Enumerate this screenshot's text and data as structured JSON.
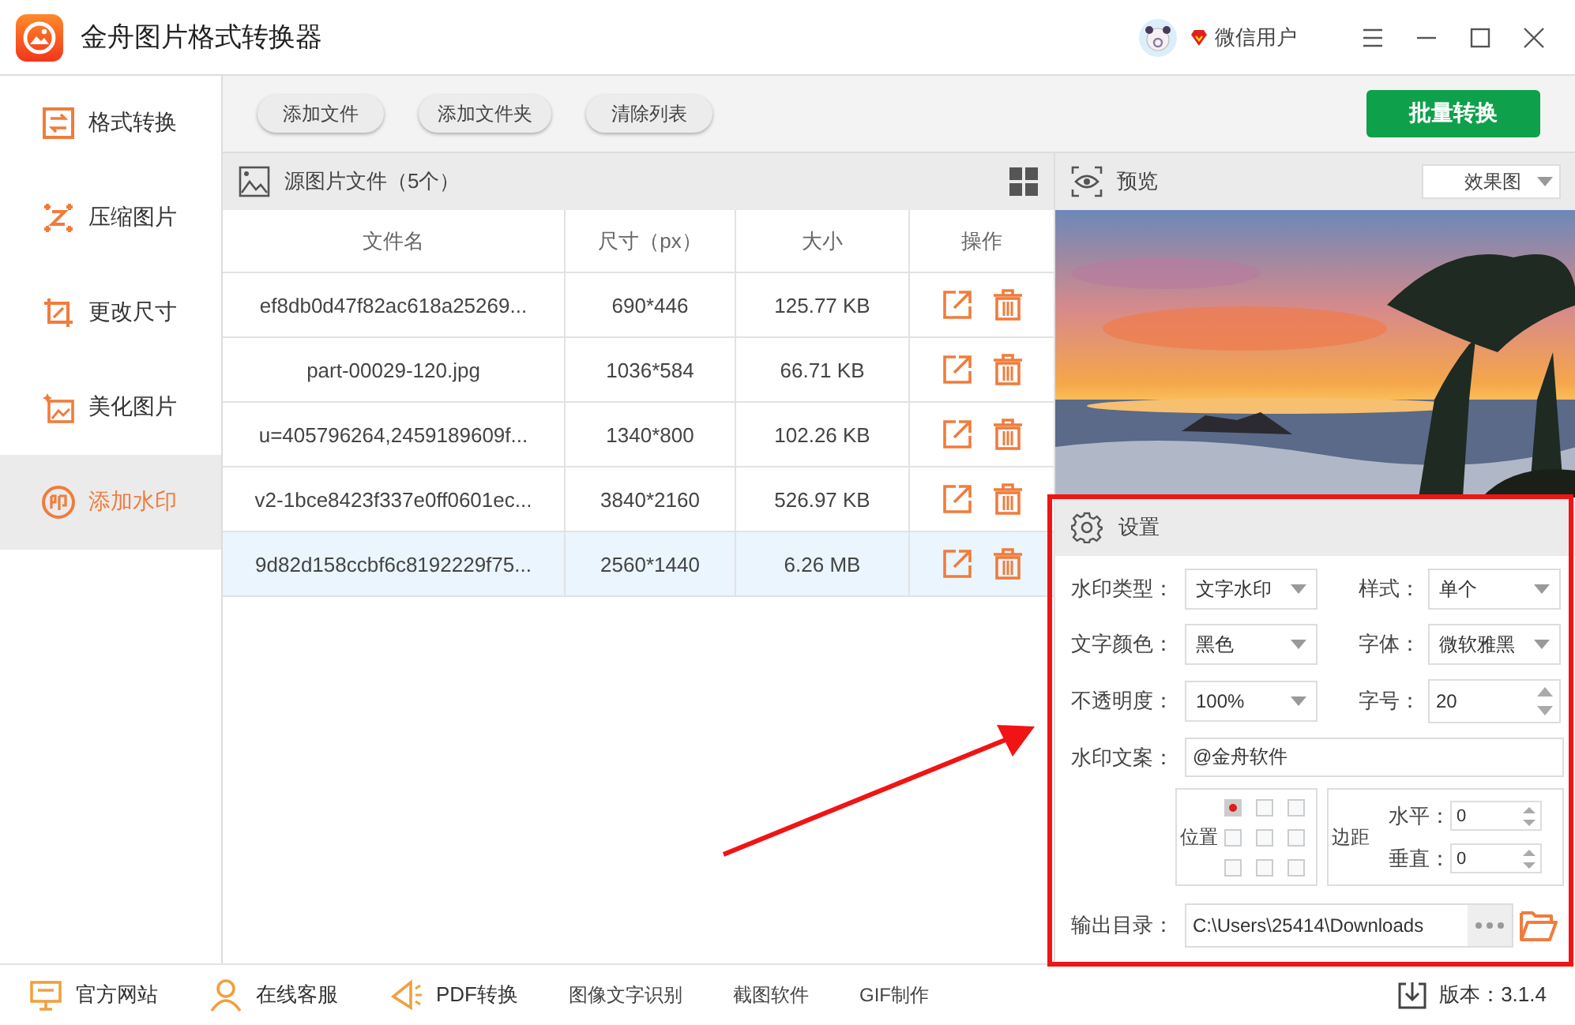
{
  "window": {
    "title": "金舟图片格式转换器",
    "user": "微信用户"
  },
  "sidebar": {
    "items": [
      {
        "label": "格式转换",
        "selected": false
      },
      {
        "label": "压缩图片",
        "selected": false
      },
      {
        "label": "更改尺寸",
        "selected": false
      },
      {
        "label": "美化图片",
        "selected": false
      },
      {
        "label": "添加水印",
        "selected": true
      }
    ]
  },
  "toolbar": {
    "buttons": [
      "添加文件",
      "添加文件夹",
      "清除列表"
    ],
    "primary_button": "批量转换"
  },
  "file_list": {
    "title": "源图片文件（5个）",
    "columns": [
      "文件名",
      "尺寸（px）",
      "大小",
      "操作"
    ],
    "rows": [
      {
        "name": "ef8db0d47f82ac618a25269...",
        "dimensions": "690*446",
        "size": "125.77 KB",
        "selected": false
      },
      {
        "name": "part-00029-120.jpg",
        "dimensions": "1036*584",
        "size": "66.71 KB",
        "selected": false
      },
      {
        "name": "u=405796264,2459189609f...",
        "dimensions": "1340*800",
        "size": "102.26 KB",
        "selected": false
      },
      {
        "name": "v2-1bce8423f337e0ff0601ec...",
        "dimensions": "3840*2160",
        "size": "526.97 KB",
        "selected": false
      },
      {
        "name": "9d82d158ccbf6c8192229f75...",
        "dimensions": "2560*1440",
        "size": "6.26 MB",
        "selected": true
      }
    ]
  },
  "preview": {
    "title": "预览",
    "mode": "效果图"
  },
  "settings": {
    "title": "设置",
    "fields": [
      {
        "label": "水印类型：",
        "kind": "dropdown",
        "value": "文字水印"
      },
      {
        "label": "样式：",
        "kind": "dropdown",
        "value": "单个"
      },
      {
        "label": "文字颜色：",
        "kind": "dropdown",
        "value": "黑色"
      },
      {
        "label": "字体：",
        "kind": "dropdown",
        "value": "微软雅黑"
      },
      {
        "label": "不透明度：",
        "kind": "dropdown",
        "value": "100%"
      },
      {
        "label": "字号：",
        "kind": "spinner",
        "value": "20"
      }
    ],
    "text": {
      "label": "水印文案：",
      "value": "@金舟软件"
    },
    "position": {
      "label": "位置",
      "cells": [
        {
          "selected": true
        },
        {
          "selected": false
        },
        {
          "selected": false
        },
        {
          "selected": false
        },
        {
          "selected": false
        },
        {
          "selected": false
        },
        {
          "selected": false
        },
        {
          "selected": false
        },
        {
          "selected": false
        }
      ]
    },
    "margin": {
      "label": "边距",
      "fields": [
        {
          "label": "水平：",
          "value": "0"
        },
        {
          "label": "垂直：",
          "value": "0"
        }
      ]
    },
    "output": {
      "label": "输出目录：",
      "value": "C:\\Users\\25414\\Downloads"
    }
  },
  "footer": {
    "links": [
      {
        "label": "官方网站",
        "kind": "monitor"
      },
      {
        "label": "在线客服",
        "kind": "person"
      },
      {
        "label": "PDF转换",
        "kind": "pdf"
      },
      {
        "label": "图像文字识别",
        "kind": "plain"
      },
      {
        "label": "截图软件",
        "kind": "plain"
      },
      {
        "label": "GIF制作",
        "kind": "plain"
      }
    ],
    "version": "版本：3.1.4"
  }
}
